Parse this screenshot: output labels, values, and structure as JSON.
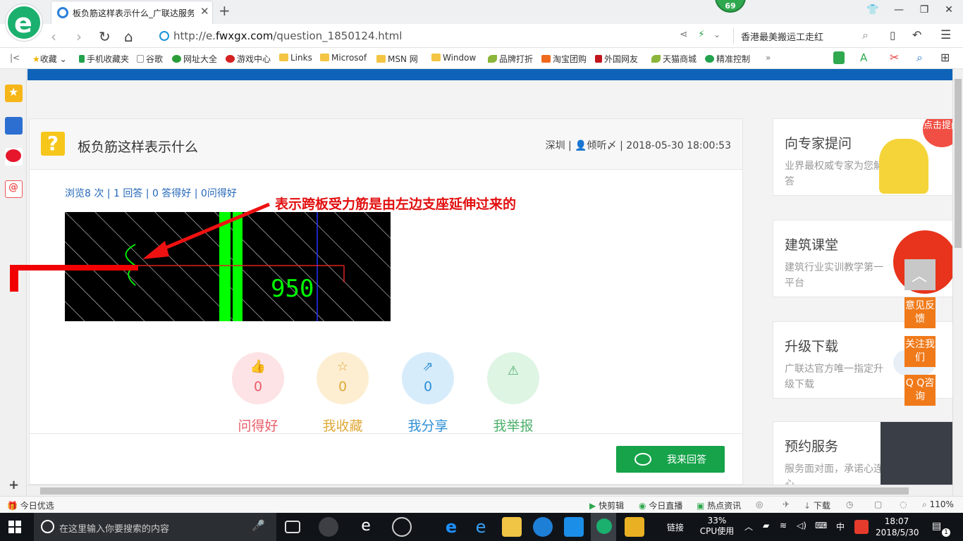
{
  "browser": {
    "tab_title": "板负筋这样表示什么_广联达服务",
    "badge": "69",
    "url_prefix": "http://e.",
    "url_domain": "fwxgx.com",
    "url_path": "/question_1850124.html",
    "search_text": "香港最美搬运工走红"
  },
  "bookmarks": [
    {
      "label": "收藏",
      "icon": "star-icon"
    },
    {
      "label": "手机收藏夹",
      "icon": "phone-icon"
    },
    {
      "label": "谷歌",
      "icon": "page-icon"
    },
    {
      "label": "网址大全",
      "icon": "globe-icon"
    },
    {
      "label": "游戏中心",
      "icon": "game-icon"
    },
    {
      "label": "Links",
      "icon": "folder-icon"
    },
    {
      "label": "Microsof",
      "icon": "folder-icon"
    },
    {
      "label": "MSN 网",
      "icon": "folder-icon"
    },
    {
      "label": "Window",
      "icon": "folder-icon"
    },
    {
      "label": "品牌打折",
      "icon": "leaf-icon"
    },
    {
      "label": "淘宝团购",
      "icon": "taobao-icon"
    },
    {
      "label": "外国网友",
      "icon": "flag-icon"
    },
    {
      "label": "天猫商城",
      "icon": "leaf-icon"
    },
    {
      "label": "精准控制",
      "icon": "chat-icon"
    }
  ],
  "question": {
    "title": "板负筋这样表示什么",
    "location": "深圳",
    "user": "倾听〆",
    "datetime": "2018-05-30 18:00:53",
    "stats": "浏览8 次 | 1 回答 | 0 答得好 | 0问得好",
    "annotation": "表示跨板受力筋是由左边支座延伸过来的",
    "cad_dimension": "950"
  },
  "actions": [
    {
      "label": "问得好",
      "count": "0",
      "icon": "thumbs-up-icon",
      "color": "#e85d6a",
      "bg": "#fde3e5"
    },
    {
      "label": "我收藏",
      "count": "0",
      "icon": "star-icon",
      "color": "#e0a93a",
      "bg": "#fdeed2"
    },
    {
      "label": "我分享",
      "count": "0",
      "icon": "share-icon",
      "color": "#2e8fd6",
      "bg": "#d7ecfb"
    },
    {
      "label": "我举报",
      "count": "0",
      "icon": "warning-icon",
      "color": "#4caf6a",
      "bg": "#def5e4"
    }
  ],
  "answer_button": "我来回答",
  "side_cards": [
    {
      "title": "向专家提问",
      "sub": "业界最权威专家为您解答",
      "badge": "点击提问"
    },
    {
      "title": "建筑课堂",
      "sub": "建筑行业实训教学第一平台"
    },
    {
      "title": "升级下载",
      "sub": "广联达官方唯一指定升级下载"
    },
    {
      "title": "预约服务",
      "sub": "服务面对面，承诺心连心"
    }
  ],
  "float_buttons": [
    "意见反馈",
    "关注我们",
    "Q Q咨询"
  ],
  "statusbar": {
    "left": "今日优选",
    "items": [
      "快剪辑",
      "今日直播",
      "热点资讯",
      "下载"
    ],
    "zoom": "110%"
  },
  "taskbar": {
    "search_placeholder": "在这里输入你要搜索的内容",
    "link": "链接",
    "cpu_percent": "33%",
    "cpu_label": "CPU使用",
    "ime": "中",
    "time": "18:07",
    "date": "2018/5/30",
    "notif": "1"
  }
}
